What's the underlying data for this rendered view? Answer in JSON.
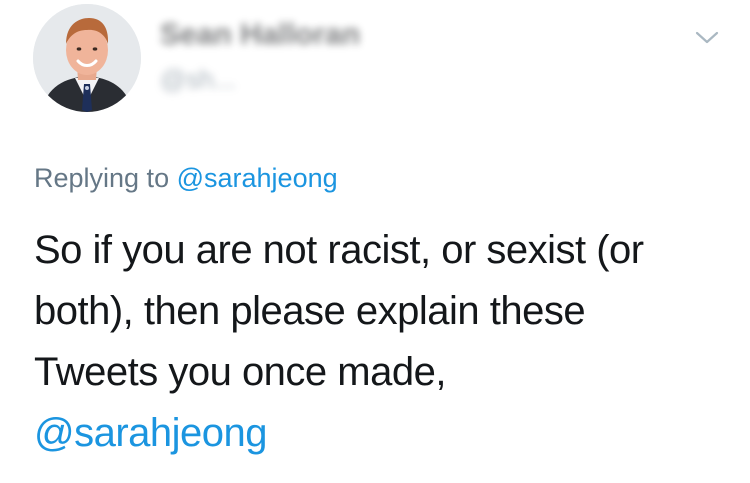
{
  "tweet": {
    "author": {
      "name": "Sean Halloran",
      "handle": "@sh..."
    },
    "menu_icon": "chevron-down-icon",
    "replying": {
      "prefix": "Replying to",
      "mention": "@sarahjeong"
    },
    "text_lines": [
      "So if you are not racist, or sexist (or",
      "both), then please explain these",
      "Tweets you once made,"
    ],
    "text_mention": "@sarahjeong",
    "colors": {
      "link": "#1b95e0",
      "secondary": "#657786",
      "primary": "#14171a"
    }
  }
}
